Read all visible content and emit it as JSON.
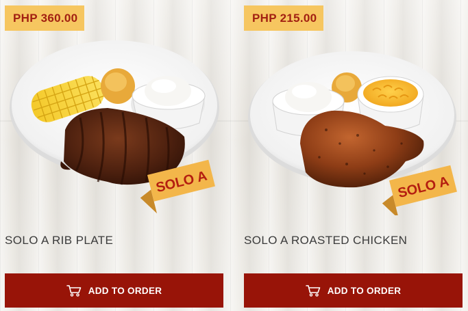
{
  "products": [
    {
      "price": "PHP 360.00",
      "name": "SOLO A RIB PLATE",
      "badge": "SOLO A",
      "button_label": "ADD TO ORDER",
      "icon": "cart-icon"
    },
    {
      "price": "PHP 215.00",
      "name": "SOLO A ROASTED CHICKEN",
      "badge": "SOLO A",
      "button_label": "ADD TO ORDER",
      "icon": "cart-icon"
    }
  ],
  "colors": {
    "price_tag_bg": "#f6c660",
    "price_text": "#a22012",
    "button_bg": "#981408",
    "badge_bg": "#f3b64a"
  }
}
